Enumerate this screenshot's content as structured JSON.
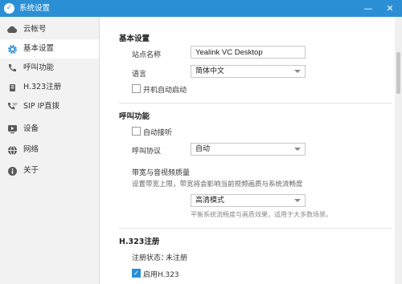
{
  "window": {
    "title": "系统设置",
    "minimize": "—",
    "close": "✕"
  },
  "sidebar": {
    "items": [
      {
        "label": "云帐号",
        "icon": "cloud-icon"
      },
      {
        "label": "基本设置",
        "icon": "gear-icon",
        "active": true
      },
      {
        "label": "呼叫功能",
        "icon": "phone-icon"
      },
      {
        "label": "H.323注册",
        "icon": "h323-icon"
      },
      {
        "label": "SIP IP直拨",
        "icon": "sip-icon"
      },
      {
        "label": "设备",
        "icon": "device-icon"
      },
      {
        "label": "网络",
        "icon": "globe-icon"
      },
      {
        "label": "关于",
        "icon": "info-icon"
      }
    ]
  },
  "basic": {
    "title": "基本设置",
    "site_name_label": "站点名称",
    "site_name_value": "Yealink VC Desktop",
    "language_label": "语言",
    "language_value": "简体中文",
    "autostart_label": "开机自动启动",
    "autostart_checked": false
  },
  "call": {
    "title": "呼叫功能",
    "auto_answer_label": "自动接听",
    "auto_answer_checked": false,
    "protocol_label": "呼叫协议",
    "protocol_value": "自动",
    "bandwidth_title": "带宽与音视频质量",
    "bandwidth_desc": "设置带宽上限，带宽将会影响当前视频画质与系统流畅度",
    "quality_value": "高清模式",
    "quality_hint": "平衡系统流畅度与画质效果，适用于大多数场景。"
  },
  "h323": {
    "title": "H.323注册",
    "status_label": "注册状态：",
    "status_value": "未注册",
    "enable_label": "启用H.323",
    "enable_checked": true
  },
  "colors": {
    "accent": "#2b8fd6"
  }
}
